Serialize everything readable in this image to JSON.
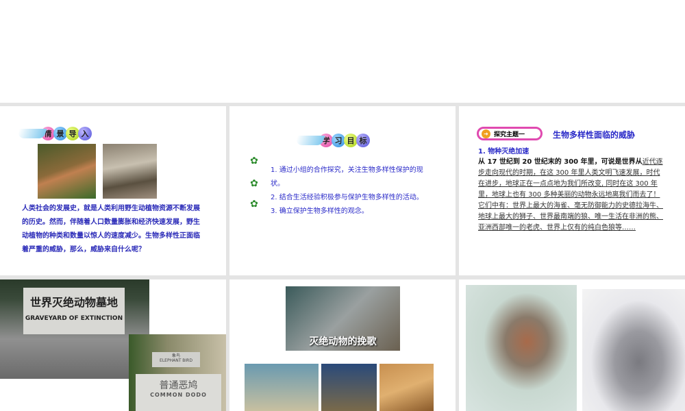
{
  "slides": [
    {
      "banner": [
        "情",
        "景",
        "导",
        "入"
      ],
      "text": "人类社会的发展史，就是人类利用野生动植物资源不断发展的历史。然而，伴随着人口数量膨胀和经济快速发展，野生动植物的种类和数量以惊人的速度减少。生物多样性正面临着严重的威胁，那么，威胁来自什么呢？"
    },
    {
      "banner": [
        "学",
        "习",
        "目",
        "标"
      ],
      "goals": [
        "1. 通过小组的合作探究，关注生物多样性保护的现状。",
        "2. 结合生活经验积极参与保护生物多样性的活动。",
        "3. 确立保护生物多样性的观念。"
      ]
    },
    {
      "tag": "探究主题一",
      "title": "生物多样性面临的威胁",
      "subtitle": "1. 物种灭绝加速",
      "lead": "从 17 世纪到 20 世纪末的 300 年里，可说是世界从",
      "body": "近代逐步走向现代的时期，在这 300 年里人类文明飞速发展，时代在进步，地球正在一点点地为我们所改变, 同时在这 300 年里，地球上也有 300 多种美丽的动物永远地离我们而去了！它们中有：世界上最大的海雀、毫无防御能力的史德拉海牛、地球上最大的狮子、世界最南端的狼、唯一生活在非洲的熊、亚洲西部唯一的老虎、世界上仅有的纯白色狼等……"
    },
    {
      "sign_cn": "世界灭绝动物墓地",
      "sign_en": "GRAVEYARD OF EXTINCTION",
      "stone_small": "象鸟",
      "stone_small_en": "ELEPHANT BIRD",
      "stone_cn": "普通恶鸠",
      "stone_en": "COMMON DODO"
    },
    {
      "image_caption": "灭绝动物的挽歌"
    },
    {}
  ]
}
